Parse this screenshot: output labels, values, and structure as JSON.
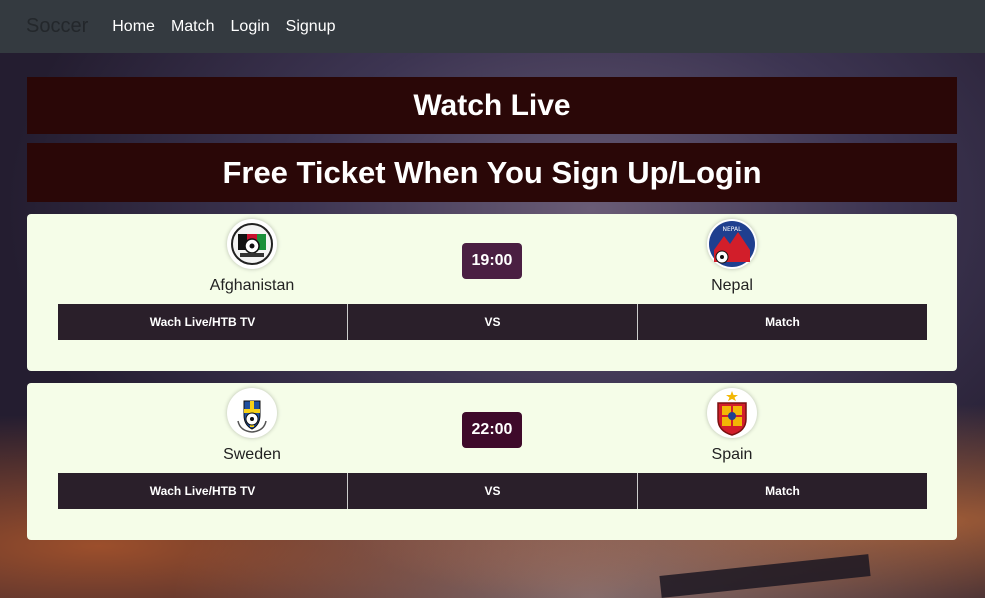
{
  "navbar": {
    "brand": "Soccer",
    "links": [
      "Home",
      "Match",
      "Login",
      "Signup"
    ]
  },
  "banners": {
    "watch_live": "Watch Live",
    "free_ticket": "Free Ticket When You Sign Up/Login"
  },
  "matches": [
    {
      "home": {
        "name": "Afghanistan",
        "logo": "afghanistan-football-crest"
      },
      "away": {
        "name": "Nepal",
        "logo": "nepal-football-crest"
      },
      "time": "19:00",
      "actions": [
        "Wach Live/HTB TV",
        "VS",
        "Match"
      ]
    },
    {
      "home": {
        "name": "Sweden",
        "logo": "sweden-football-crest"
      },
      "away": {
        "name": "Spain",
        "logo": "spain-football-crest"
      },
      "time": "22:00",
      "actions": [
        "Wach Live/HTB TV",
        "VS",
        "Match"
      ]
    }
  ],
  "colors": {
    "navbar": "#343a40",
    "banner": "#2a0707",
    "card": "#f5fde8",
    "action_bar": "#2a1f2a",
    "time_badge_1": "#4a1f42",
    "time_badge_2": "#3e0a2a"
  }
}
